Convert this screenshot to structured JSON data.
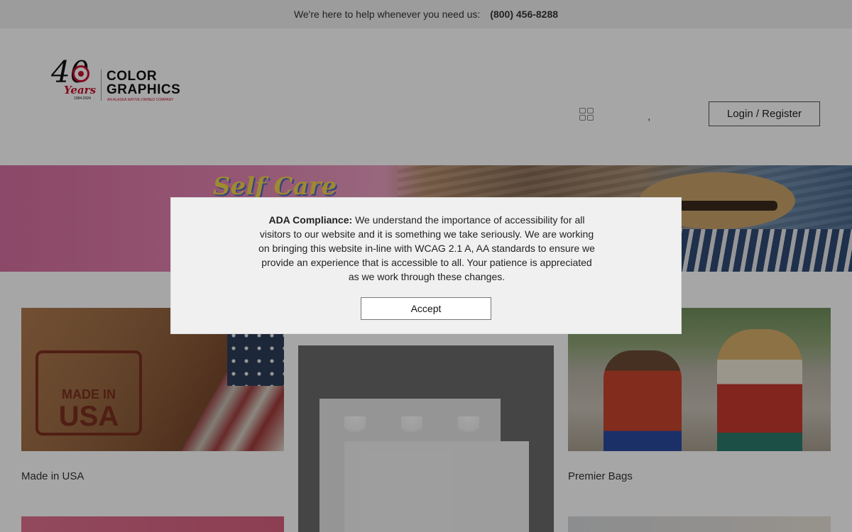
{
  "topbar": {
    "help_text": "We're here to help whenever you need us:",
    "phone": "(800) 456-8288"
  },
  "header": {
    "logo": {
      "years_number": "40",
      "years_text": "Years",
      "year_range": "1984-2024",
      "brand_line1": "COLOR",
      "brand_line2": "GRAPHICS",
      "tagline": "AN ALASKA NATIVE-OWNED COMPANY"
    },
    "grid_icon": "grid-icon",
    "separator": ",",
    "login_label": "Login / Register"
  },
  "banner": {
    "text": "Self Care"
  },
  "products": [
    {
      "label": "Made in USA",
      "stamp_line1": "MADE IN",
      "stamp_line2": "USA"
    },
    {
      "label": ""
    },
    {
      "label": "Premier Bags"
    }
  ],
  "modal": {
    "title": "ADA Compliance:",
    "body": "We understand the importance of accessibility for all visitors to our website and it is something we take seriously. We are working on bringing this website in-line with WCAG 2.1 A, AA standards to ensure we provide an experience that is accessible to all. Your patience is appreciated as we work through these changes.",
    "accept_label": "Accept"
  },
  "colors": {
    "overlay": "#000000",
    "accent_red": "#c8102e"
  }
}
